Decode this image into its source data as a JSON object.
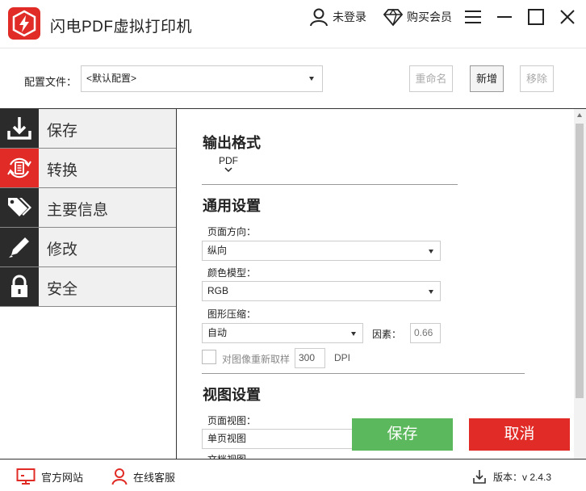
{
  "app": {
    "title": "闪电PDF虚拟打印机"
  },
  "titlebar": {
    "login": "未登录",
    "vip": "购买会员"
  },
  "config": {
    "label": "配置文件：",
    "selected": "<默认配置>",
    "rename": "重命名",
    "new": "新增",
    "remove": "移除"
  },
  "sidebar": {
    "items": [
      {
        "label": "保存",
        "icon": "download-icon"
      },
      {
        "label": "转换",
        "icon": "convert-icon"
      },
      {
        "label": "主要信息",
        "icon": "tag-icon"
      },
      {
        "label": "修改",
        "icon": "pencil-icon"
      },
      {
        "label": "安全",
        "icon": "lock-icon"
      }
    ],
    "active_index": 1
  },
  "main": {
    "output_format": {
      "title": "输出格式",
      "value": "PDF"
    },
    "general": {
      "title": "通用设置",
      "orientation_label": "页面方向：",
      "orientation_value": "纵向",
      "color_label": "颜色模型：",
      "color_value": "RGB",
      "compress_label": "图形压缩：",
      "compress_value": "自动",
      "factor_label": "因素：",
      "factor_value": "0.66",
      "resample_label": "对图像重新取样",
      "dpi_value": "300",
      "dpi_unit": "DPI"
    },
    "view": {
      "title": "视图设置",
      "page_view_label": "页面视图：",
      "page_view_value": "单页视图",
      "doc_view_label": "文档视图"
    }
  },
  "actions": {
    "save": "保存",
    "cancel": "取消"
  },
  "footer": {
    "website": "官方网站",
    "support": "在线客服",
    "version": "版本：v 2.4.3"
  },
  "colors": {
    "accent_red": "#e02b26",
    "save_green": "#5cb85c",
    "dark_icon_bg": "#2b2b2b"
  }
}
